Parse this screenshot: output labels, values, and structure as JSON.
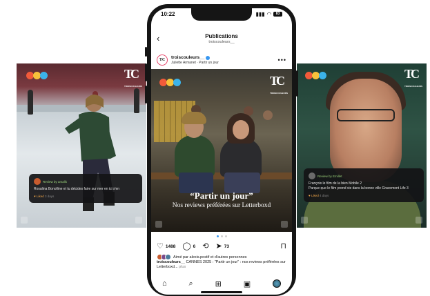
{
  "status_bar": {
    "time": "10:22",
    "battery": "83"
  },
  "header": {
    "title": "Publications",
    "subtitle": "troiscouleurs__"
  },
  "post": {
    "username": "troiscouleurs__",
    "meta": "Juliette Armanet · Partir un jour",
    "title_line1": "“Partir un jour”",
    "title_line2": "Nos reviews préférées sur Letterboxd",
    "likes": "1488",
    "comments": "6",
    "shares": "73",
    "liked_by": "Aimé par alexis.postif et d'autres personnes",
    "caption_user": "troiscouleurs__",
    "caption_text": "CANNES 2025 : \"Partir un jour\" : nos reviews préférées sur Letterboxd...",
    "caption_more": "plus",
    "slide_count": 3,
    "active_slide": 1
  },
  "left_card": {
    "reviewer": "Review by amalik",
    "review_text": "Rosalina Bonolline et tu décides faire sur mer en ici s'en",
    "liked": "Liked",
    "liked_ago": "3 days"
  },
  "right_card": {
    "reviewer": "Review by Emillet",
    "review_text": "François le film de la bien Mobile 2",
    "review_sub": "Parque que le film prend vie dans la bonne ville Gravement Life 3",
    "liked": "Liked",
    "liked_ago": "4 days"
  },
  "brand": {
    "logo_text": "TC",
    "logo_sub": "TROISCOULEURS"
  },
  "colors": {
    "dot_red": "#f15a3a",
    "dot_yellow": "#f7c23b",
    "dot_blue": "#3bb3e9",
    "accent": "#3897f0"
  },
  "icons": {
    "back": "chevron-left-icon",
    "more": "more-dots-icon",
    "like": "heart-icon",
    "comment": "comment-icon",
    "repost": "repost-icon",
    "share": "send-icon",
    "save": "bookmark-icon",
    "nav": [
      "home-icon",
      "search-icon",
      "create-icon",
      "reels-icon",
      "profile-avatar"
    ]
  }
}
